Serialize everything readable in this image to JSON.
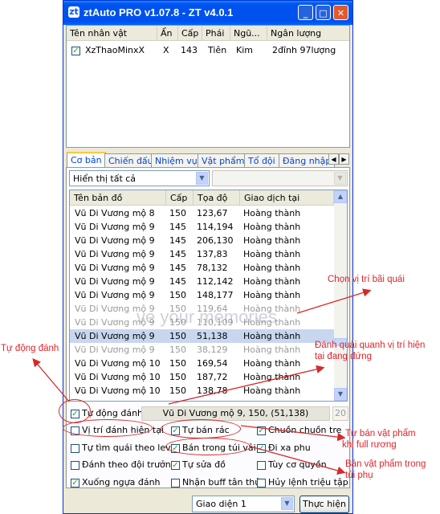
{
  "window": {
    "title": "ztAuto PRO v1.07.8 - ZT v4.0.1",
    "icon_text": "zt",
    "minimize_icon": "minimize-icon",
    "maximize_icon": "maximize-icon",
    "close_icon": "close-icon"
  },
  "characters": {
    "headers": [
      "Tên nhân vật",
      "Ẩn",
      "Cấp",
      "Phái",
      "Ngũ...",
      "Ngân lượng"
    ],
    "rows": [
      {
        "checked": true,
        "name": "XzThaoMinxX",
        "hidden": "X",
        "level": "143",
        "faction": "Tiên",
        "element": "Kim",
        "money": "2đĩnh 97lượng"
      }
    ]
  },
  "tabs": [
    "Cơ bản",
    "Chiến đấu",
    "Nhiệm vụ",
    "Vật phẩm",
    "Tổ đội",
    "Đăng nhập"
  ],
  "filter": {
    "selected": "Hiển thị tất cả",
    "secondary": ""
  },
  "maps": {
    "headers": [
      "Tên bản đồ",
      "Cấp",
      "Tọa độ",
      "Giao dịch tại"
    ],
    "rows": [
      {
        "name": "Vũ Di Vương mộ 8",
        "level": "150",
        "coord": "123,67",
        "trade": "Hoàng thành",
        "state": "normal"
      },
      {
        "name": "Vũ Di Vương mộ 9",
        "level": "145",
        "coord": "114,194",
        "trade": "Hoàng thành",
        "state": "normal"
      },
      {
        "name": "Vũ Di Vương mộ 9",
        "level": "145",
        "coord": "206,130",
        "trade": "Hoàng thành",
        "state": "normal"
      },
      {
        "name": "Vũ Di Vương mộ 9",
        "level": "145",
        "coord": "137,83",
        "trade": "Hoàng thành",
        "state": "normal"
      },
      {
        "name": "Vũ Di Vương mộ 9",
        "level": "145",
        "coord": "78,132",
        "trade": "Hoàng thành",
        "state": "normal"
      },
      {
        "name": "Vũ Di Vương mộ 9",
        "level": "145",
        "coord": "112,142",
        "trade": "Hoàng thành",
        "state": "normal"
      },
      {
        "name": "Vũ Di Vương mộ 9",
        "level": "150",
        "coord": "148,177",
        "trade": "Hoàng thành",
        "state": "normal"
      },
      {
        "name": "Vũ Di Vương mộ 9",
        "level": "150",
        "coord": "119,64",
        "trade": "Hoàng thành",
        "state": "dim"
      },
      {
        "name": "Vũ Di Vương mộ 9",
        "level": "150",
        "coord": "110,109",
        "trade": "Hoàng thành",
        "state": "dim"
      },
      {
        "name": "Vũ Di Vương mộ 9",
        "level": "150",
        "coord": "51,138",
        "trade": "Hoàng thành",
        "state": "selected"
      },
      {
        "name": "Vũ Di Vương mộ 9",
        "level": "150",
        "coord": "38,129",
        "trade": "Hoàng thành",
        "state": "dim"
      },
      {
        "name": "Vũ Di Vương mộ 10",
        "level": "150",
        "coord": "169,54",
        "trade": "Hoàng thành",
        "state": "normal"
      },
      {
        "name": "Vũ Di Vương mộ 10",
        "level": "150",
        "coord": "187,72",
        "trade": "Hoàng thành",
        "state": "normal"
      },
      {
        "name": "Vũ Di Vương mộ 10",
        "level": "150",
        "coord": "138,78",
        "trade": "Hoàng thành",
        "state": "normal"
      }
    ]
  },
  "auto_fight": {
    "label": "Tự động đánh",
    "checked": true,
    "position": "Vũ Di Vương mộ 9, 150, (51,138)",
    "radius": "20"
  },
  "options": [
    {
      "label": "Vị trí đánh hiện tại",
      "checked": false
    },
    {
      "label": "Tự bán rác",
      "checked": true
    },
    {
      "label": "Chuồn chuồn tre",
      "checked": true
    },
    {
      "label": "Tự tìm quái theo level",
      "checked": false
    },
    {
      "label": "Bán trong túi vải",
      "checked": true
    },
    {
      "label": "Đi xa phu",
      "checked": true
    },
    {
      "label": "Đánh theo đội trưởng",
      "checked": false
    },
    {
      "label": "Tự sửa đồ",
      "checked": true
    },
    {
      "label": "Tùy cơ quyền",
      "checked": false
    },
    {
      "label": "Xuống ngựa đánh",
      "checked": true
    },
    {
      "label": "Nhận buff tân thủ",
      "checked": false
    },
    {
      "label": "Hủy lệnh triệu tập",
      "checked": false
    }
  ],
  "bottom": {
    "interface_select": "Giao diện 1",
    "run_button": "Thực hiện"
  },
  "watermark": "ve your memories",
  "annotations": {
    "choose_location": "Chọn vị trí bãi quái",
    "auto_fight": "Tự động đánh",
    "fight_around": [
      "Đánh quái quanh vị trí hiện",
      "tại đang đứng"
    ],
    "sell_junk": [
      "Tự bán vật phẩm",
      "khi full rương"
    ],
    "sell_bag": [
      "Bán vật phẩm trong",
      "túi phụ"
    ]
  },
  "colors": {
    "annotation": "#e0242a",
    "title_bar": "#0053ee",
    "tab_text": "#0046d5"
  }
}
